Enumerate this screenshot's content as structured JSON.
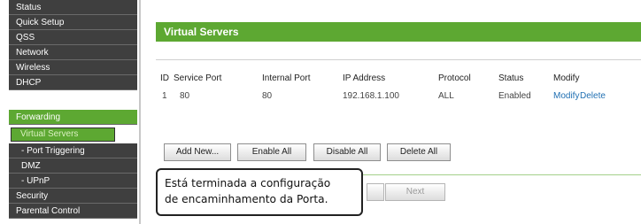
{
  "sidebar": {
    "items": [
      {
        "label": "Status"
      },
      {
        "label": "Quick Setup"
      },
      {
        "label": "QSS"
      },
      {
        "label": "Network"
      },
      {
        "label": "Wireless"
      },
      {
        "label": "DHCP"
      },
      {
        "label": "Forwarding"
      },
      {
        "label": "Virtual Servers"
      },
      {
        "label": "- Port Triggering"
      },
      {
        "label": "DMZ"
      },
      {
        "label": "- UPnP"
      },
      {
        "label": "Security"
      },
      {
        "label": "Parental Control"
      }
    ]
  },
  "panel": {
    "title": "Virtual Servers"
  },
  "table": {
    "headers": [
      "ID",
      "Service Port",
      "Internal Port",
      "IP Address",
      "Protocol",
      "Status",
      "Modify"
    ],
    "rows": [
      {
        "id": "1",
        "service_port": "80",
        "internal_port": "80",
        "ip_address": "192.168.1.100",
        "protocol": "ALL",
        "status": "Enabled",
        "modify_label": "Modify",
        "delete_label": "Delete"
      }
    ]
  },
  "buttons": {
    "add_new": "Add New...",
    "enable_all": "Enable All",
    "disable_all": "Disable All",
    "delete_all": "Delete All",
    "next": "Next"
  },
  "callout": {
    "line1": "Está terminada a configuração",
    "line2": "de encaminhamento da Porta."
  },
  "colors": {
    "accent": "#5da832",
    "nav_background": "#3f3f3f",
    "link": "#1f6fb2"
  }
}
